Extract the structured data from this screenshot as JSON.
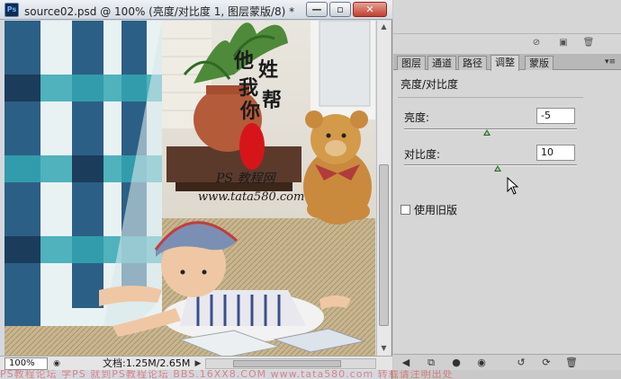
{
  "document": {
    "app_badge": "Ps",
    "title": "source02.psd @ 100% (亮度/对比度 1, 图层蒙版/8) *",
    "window_controls": {
      "minimize_icon": "minimize-icon",
      "restore_icon": "restore-icon",
      "close_icon": "close-icon"
    },
    "canvas": {
      "calligraphy": [
        "他",
        "姓",
        "我",
        "帮",
        "你"
      ],
      "overlay_brand": "PS 教程网",
      "overlay_url": "www.tata580.com"
    },
    "status": {
      "zoom": "100%",
      "doc_size": "文档:1.25M/2.65M"
    }
  },
  "panel": {
    "tabs": [
      {
        "label": "图层",
        "active": false
      },
      {
        "label": "通道",
        "active": false
      },
      {
        "label": "路径",
        "active": false
      },
      {
        "label": "调整",
        "active": true
      },
      {
        "label": "蒙版",
        "active": false
      }
    ],
    "adjustment": {
      "title": "亮度/对比度",
      "brightness": {
        "label": "亮度:",
        "value": "-5",
        "slider_fraction": 0.48
      },
      "contrast": {
        "label": "对比度:",
        "value": "10",
        "slider_fraction": 0.54
      },
      "legacy_label": "使用旧版"
    }
  },
  "watermark": "PS教程论坛 学PS 就到PS教程论坛 BBS.16XX8.COM www.tata580.com 转载请注明出处"
}
